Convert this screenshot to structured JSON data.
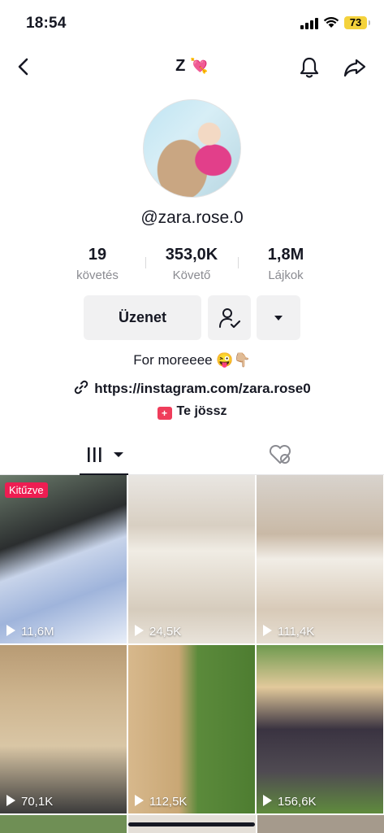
{
  "status_bar": {
    "time": "18:54",
    "battery": "73"
  },
  "header": {
    "title": "Z",
    "title_emoji": "💘"
  },
  "profile": {
    "username": "@zara.rose.0",
    "stats": [
      {
        "value": "19",
        "label": "követés"
      },
      {
        "value": "353,0K",
        "label": "Követő"
      },
      {
        "value": "1,8M",
        "label": "Lájkok"
      }
    ],
    "message_button": "Üzenet",
    "bio": "For moreeee 😜👇🏼",
    "link": "https://instagram.com/zara.rose0",
    "ticket_label": "Te jössz"
  },
  "videos": [
    {
      "views": "11,6M",
      "pinned_label": "Kitűzve"
    },
    {
      "views": "24,5K"
    },
    {
      "views": "111,4K"
    },
    {
      "views": "70,1K"
    },
    {
      "views": "112,5K"
    },
    {
      "views": "156,6K"
    }
  ],
  "colors": {
    "pinned": "#ee1d52",
    "battery": "#f4d23c",
    "accent_red": "#ef3d5b"
  }
}
